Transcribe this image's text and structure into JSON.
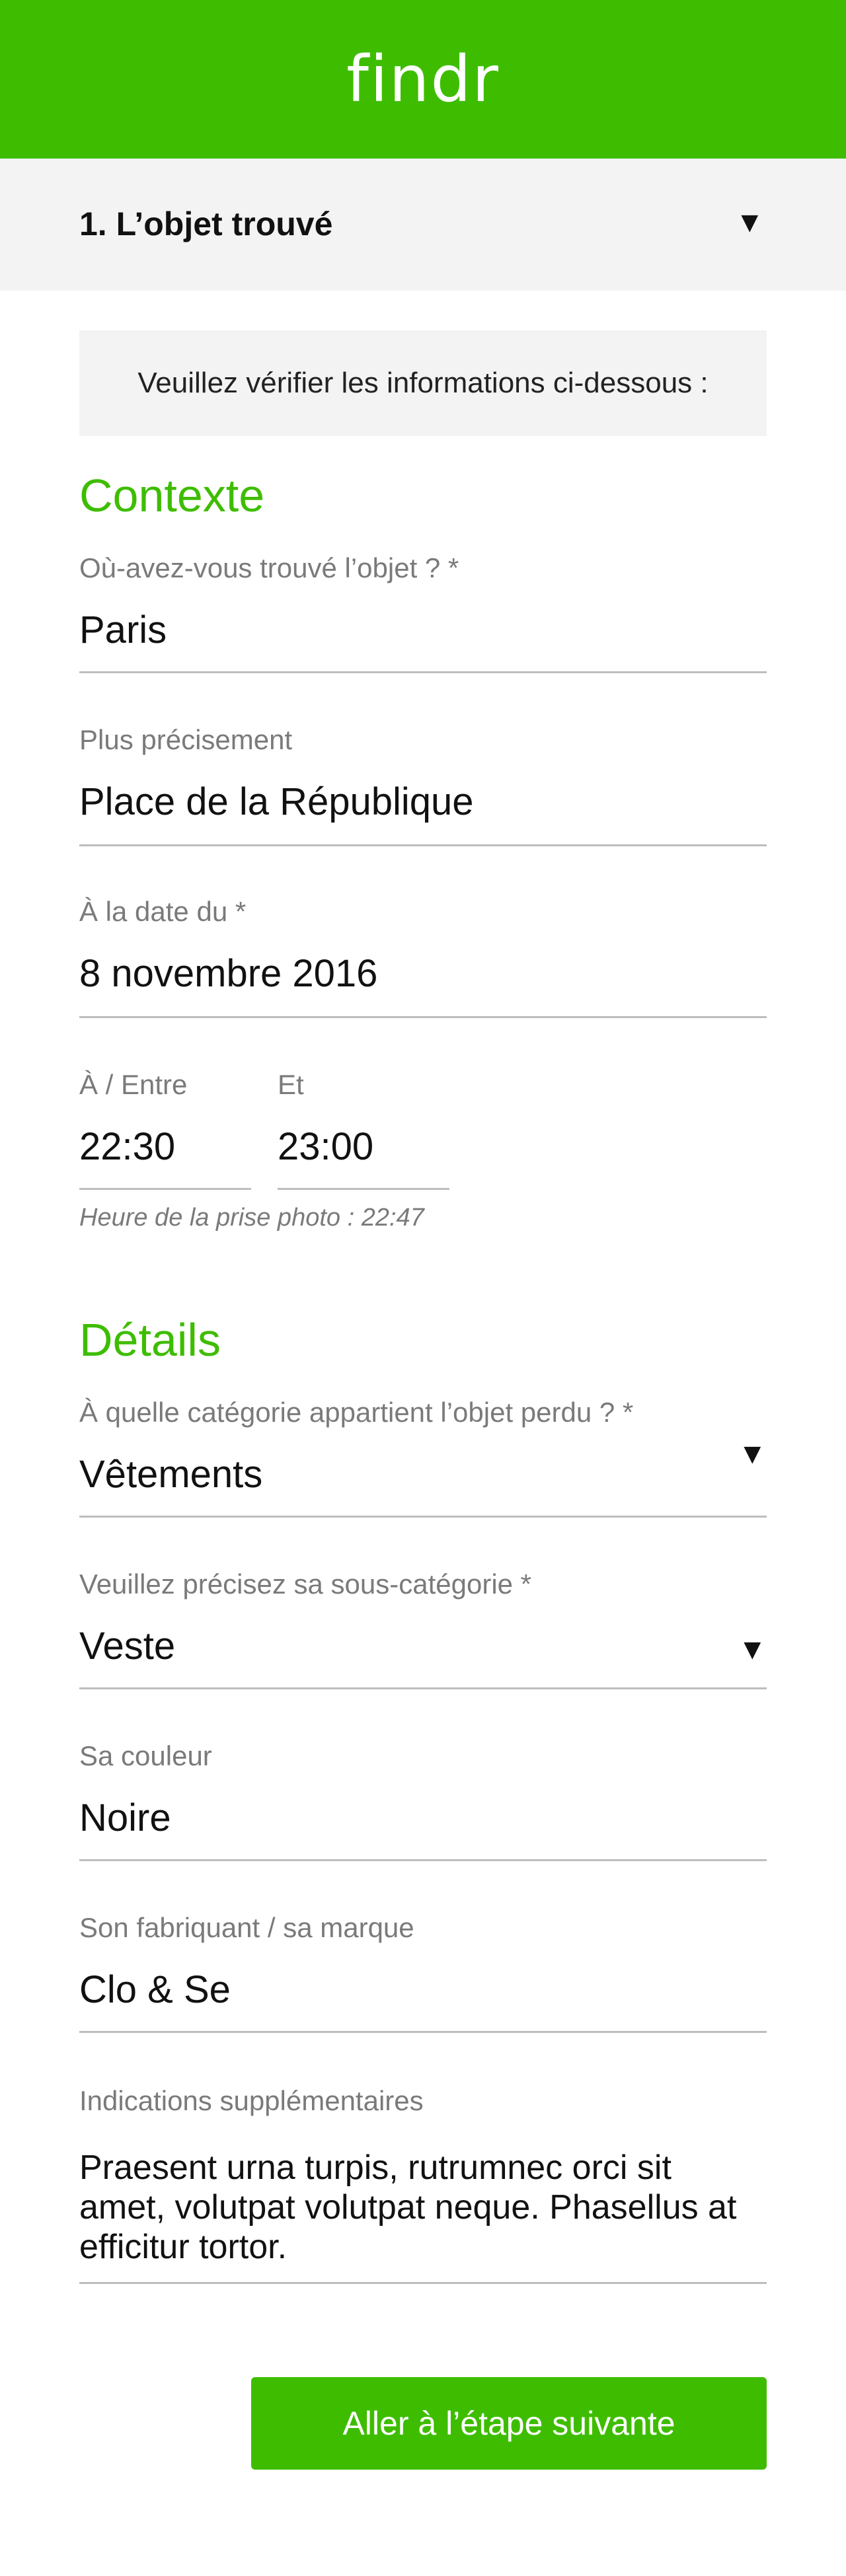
{
  "header": {
    "logo": "findr"
  },
  "step": {
    "title": "1.  L’objet trouvé",
    "toggle_icon": "▼"
  },
  "notice": "Veuillez vérifier les informations ci-dessous :",
  "context": {
    "title": "Contexte",
    "where": {
      "label": "Où-avez-vous trouvé l’objet ? *",
      "value": "Paris"
    },
    "precise": {
      "label": "Plus précisement",
      "value": "Place de la République"
    },
    "date": {
      "label": "À la date du *",
      "value": "8 novembre 2016"
    },
    "time_from": {
      "label": "À / Entre",
      "value": "22:30"
    },
    "time_to": {
      "label": "Et",
      "value": "23:00"
    },
    "photo_hint": "Heure de la prise photo : 22:47"
  },
  "details": {
    "title": "Détails",
    "category": {
      "label": "À quelle catégorie appartient l’objet perdu ? *",
      "value": "Vêtements"
    },
    "subcategory": {
      "label": "Veuillez précisez sa sous-catégorie *",
      "value": "Veste"
    },
    "color": {
      "label": "Sa couleur",
      "value": "Noire"
    },
    "brand": {
      "label": "Son fabriquant / sa marque",
      "value": "Clo & Se"
    },
    "extra": {
      "label": "Indications supplémentaires",
      "value": "Praesent urna turpis, rutrumnec orci sit amet, volutpat volutpat neque. Phasellus at efficitur tortor."
    }
  },
  "cta": {
    "label": "Aller à l’étape suivante"
  },
  "icons": {
    "dropdown": "chevron-down-icon"
  },
  "colors": {
    "accent": "#3ebd00",
    "panel": "#f3f3f3"
  }
}
